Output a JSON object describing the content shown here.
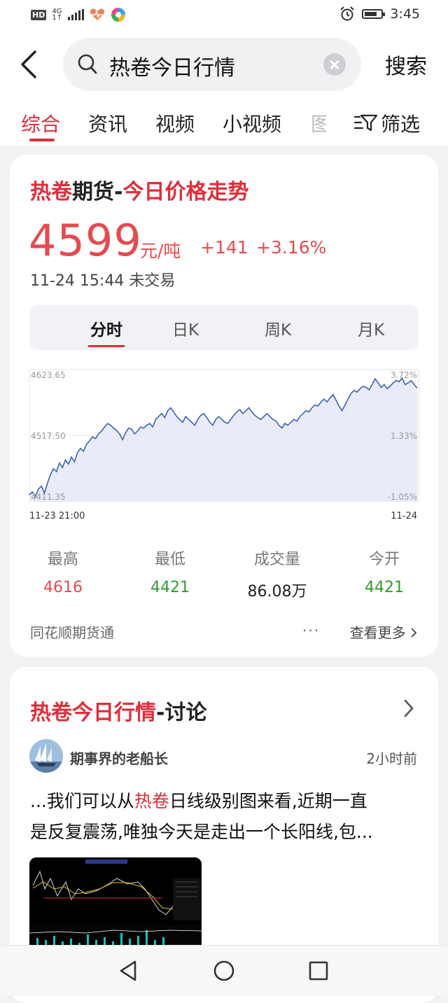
{
  "status_bar": {
    "hd": "HD",
    "net_top": "4G",
    "net_bottom": "1↑",
    "time": "3:45",
    "battery_level": 0.75
  },
  "search": {
    "query": "热卷今日行情",
    "submit_label": "搜索"
  },
  "tabs": {
    "items": [
      "综合",
      "资讯",
      "视频",
      "小视频"
    ],
    "partial": "图",
    "filter_label": "筛选"
  },
  "price_card": {
    "title_red_1": "热卷",
    "title_dark": "期货-",
    "title_red_2": "今日价格走势",
    "price": "4599",
    "unit": "元/吨",
    "change": "+141",
    "change_pct": "+3.16%",
    "timestamp": "11-24 15:44 未交易",
    "period_tabs": [
      "分时",
      "日K",
      "周K",
      "月K"
    ],
    "stats": [
      {
        "label": "最高",
        "value": "4616",
        "trend": "up"
      },
      {
        "label": "最低",
        "value": "4421",
        "trend": "down"
      },
      {
        "label": "成交量",
        "value": "86.08万",
        "trend": "neutral"
      },
      {
        "label": "今开",
        "value": "4421",
        "trend": "down"
      }
    ],
    "source": "同花顺期货通",
    "more_dots": "···",
    "see_more": "查看更多"
  },
  "chart_data": {
    "type": "area",
    "x_start_label": "11-23 21:00",
    "x_end_label": "11-24",
    "y_ticks_left": [
      "4623.65",
      "4517.50",
      "4411.35"
    ],
    "y_ticks_right": [
      "3.72%",
      "1.33%",
      "-1.05%"
    ],
    "ylim": [
      4411.35,
      4623.65
    ],
    "line_color": "#3b63b8",
    "fill_color": "#e9ecf8",
    "values": [
      4415,
      4420,
      4412,
      4425,
      4430,
      4418,
      4435,
      4450,
      4460,
      4455,
      4470,
      4462,
      4475,
      4468,
      4480,
      4472,
      4488,
      4495,
      4490,
      4502,
      4508,
      4515,
      4512,
      4520,
      4525,
      4532,
      4538,
      4535,
      4530,
      4526,
      4520,
      4510,
      4522,
      4530,
      4528,
      4520,
      4525,
      4532,
      4530,
      4535,
      4538,
      4532,
      4545,
      4550,
      4555,
      4548,
      4560,
      4565,
      4558,
      4550,
      4545,
      4540,
      4550,
      4545,
      4540,
      4535,
      4545,
      4552,
      4555,
      4548,
      4540,
      4535,
      4545,
      4550,
      4545,
      4540,
      4538,
      4545,
      4552,
      4558,
      4562,
      4555,
      4560,
      4565,
      4558,
      4552,
      4548,
      4545,
      4550,
      4555,
      4550,
      4545,
      4542,
      4535,
      4530,
      4538,
      4535,
      4540,
      4545,
      4542,
      4550,
      4555,
      4560,
      4558,
      4565,
      4570,
      4568,
      4575,
      4580,
      4575,
      4582,
      4588,
      4578,
      4568,
      4560,
      4570,
      4580,
      4590,
      4595,
      4592,
      4598,
      4602,
      4600,
      4596,
      4605,
      4615,
      4608,
      4600,
      4605,
      4598,
      4602,
      4608,
      4612,
      4610,
      4616,
      4605,
      4608,
      4612,
      4605,
      4599
    ]
  },
  "discussion": {
    "title_red": "热卷今日行情",
    "title_dark": "-讨论",
    "author": "期事界的老船长",
    "time_ago": "2小时前",
    "line1_pre": "...我们可以从",
    "line1_hl": "热卷",
    "line1_post": "日线级别图来看,近期一直",
    "line2": "是反复震荡,唯独今天是走出一个长阳线,包..."
  }
}
